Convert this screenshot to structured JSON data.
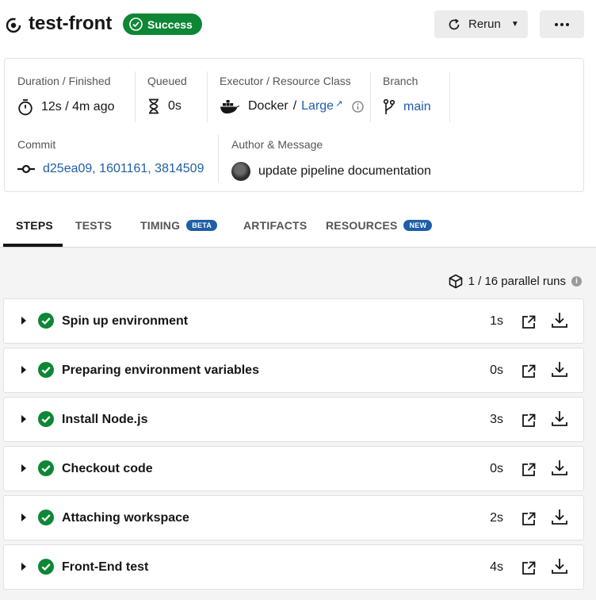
{
  "header": {
    "title": "test-front",
    "status": "Success",
    "rerun_label": "Rerun",
    "more_icon": "more-dots-icon"
  },
  "info": {
    "duration": {
      "label": "Duration / Finished",
      "value": "12s / 4m ago"
    },
    "queued": {
      "label": "Queued",
      "value": "0s"
    },
    "executor": {
      "label": "Executor / Resource Class",
      "executor": "Docker",
      "separator": "/",
      "resource_class": "Large"
    },
    "branch": {
      "label": "Branch",
      "value": "main"
    },
    "commit": {
      "label": "Commit",
      "value": "d25ea09, 1601161, 3814509"
    },
    "author": {
      "label": "Author & Message",
      "message": "update pipeline documentation"
    }
  },
  "tabs": [
    {
      "label": "STEPS",
      "badge": ""
    },
    {
      "label": "TESTS",
      "badge": ""
    },
    {
      "label": "TIMING",
      "badge": "BETA"
    },
    {
      "label": "ARTIFACTS",
      "badge": ""
    },
    {
      "label": "RESOURCES",
      "badge": "NEW"
    }
  ],
  "parallel_runs": "1 / 16 parallel runs",
  "steps": [
    {
      "name": "Spin up environment",
      "duration": "1s"
    },
    {
      "name": "Preparing environment variables",
      "duration": "0s"
    },
    {
      "name": "Install Node.js",
      "duration": "3s"
    },
    {
      "name": "Checkout code",
      "duration": "0s"
    },
    {
      "name": "Attaching workspace",
      "duration": "2s"
    },
    {
      "name": "Front-End test",
      "duration": "4s"
    }
  ],
  "colors": {
    "success": "#0d8735",
    "link": "#1f5ea8",
    "badge": "#1f5ea8"
  }
}
